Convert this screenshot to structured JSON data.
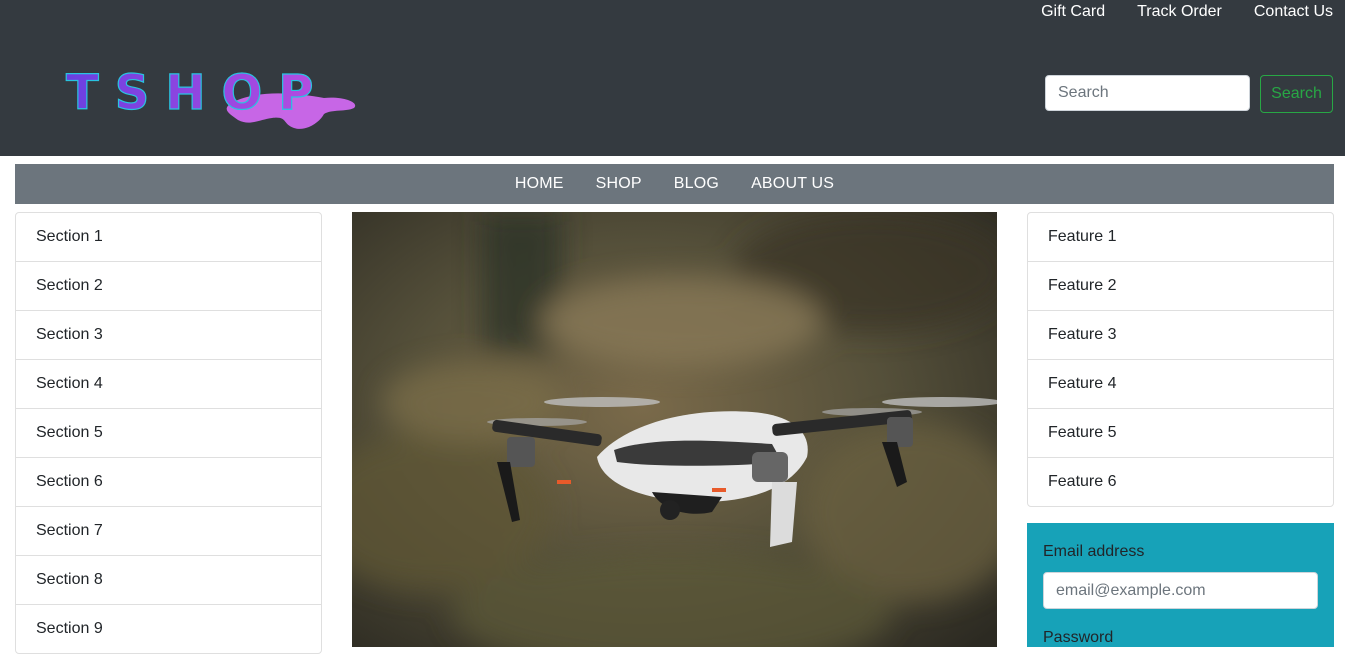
{
  "header": {
    "top_links": [
      "Gift Card",
      "Track Order",
      "Contact Us"
    ],
    "logo_text": "TSHOP",
    "search": {
      "placeholder": "Search",
      "button_label": "Search"
    }
  },
  "nav": [
    "HOME",
    "SHOP",
    "BLOG",
    "ABOUT US"
  ],
  "sections": [
    "Section 1",
    "Section 2",
    "Section 3",
    "Section 4",
    "Section 5",
    "Section 6",
    "Section 7",
    "Section 8",
    "Section 9"
  ],
  "features": [
    "Feature 1",
    "Feature 2",
    "Feature 3",
    "Feature 4",
    "Feature 5",
    "Feature 6"
  ],
  "login": {
    "email_label": "Email address",
    "email_placeholder": "email@example.com",
    "password_label": "Password"
  },
  "colors": {
    "header_bg": "#343a40",
    "nav_bg": "#6c757d",
    "search_button": "#28a745",
    "login_bg": "#17a2b8",
    "logo_gradient_start": "#7b3fe4",
    "logo_gradient_end": "#d64fd8"
  },
  "hero": {
    "image": "drone-photo"
  }
}
